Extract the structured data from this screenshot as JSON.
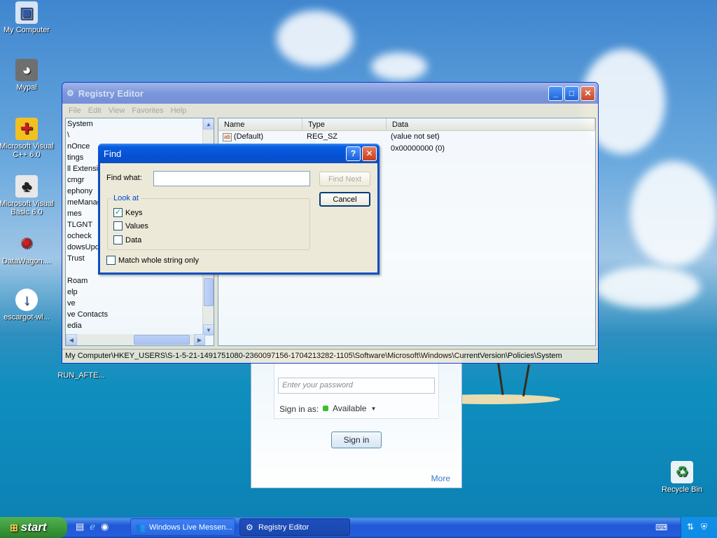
{
  "desktop": {
    "icons": [
      {
        "label": "My Computer",
        "icon": "computer-icon"
      },
      {
        "label": "Mypal",
        "icon": "raccoon-icon"
      },
      {
        "label": "Microsoft Visual C++ 6.0",
        "icon": "visual-cpp-icon"
      },
      {
        "label": "Microsoft Visual Basic 6.0",
        "icon": "visual-basic-icon"
      },
      {
        "label": "DataWagon....",
        "icon": "datawagon-icon"
      },
      {
        "label": "escargot-wl...",
        "icon": "escargot-icon"
      },
      {
        "label": "RUN_AFTE...",
        "icon": "shortcut-icon"
      },
      {
        "label": "Recycle Bin",
        "icon": "recycle-bin-icon"
      }
    ]
  },
  "messenger": {
    "password_placeholder": "Enter your password",
    "sign_in_as_label": "Sign in as:",
    "status_value": "Available",
    "sign_in_button": "Sign in",
    "more_link": "More",
    "status_color": "#3cbf2c"
  },
  "regedit": {
    "title": "Registry Editor",
    "menu": [
      "File",
      "Edit",
      "View",
      "Favorites",
      "Help"
    ],
    "tree_items": [
      "System",
      "\\",
      "nOnce",
      "tings",
      "ll Extensio",
      "cmgr",
      "ephony",
      "meManag",
      "mes",
      "TLGNT",
      "ocheck",
      "dowsUpd",
      "Trust",
      "",
      "Roam",
      "elp",
      "ve",
      "ve Contacts",
      "edia"
    ],
    "columns": [
      "Name",
      "Type",
      "Data"
    ],
    "rows": [
      {
        "name": "(Default)",
        "type": "REG_SZ",
        "data": "(value not set)"
      },
      {
        "name": "",
        "type": "",
        "data": "0x00000000 (0)"
      }
    ],
    "status_path": "My Computer\\HKEY_USERS\\S-1-5-21-1491751080-2360097156-1704213282-1105\\Software\\Microsoft\\Windows\\CurrentVersion\\Policies\\System"
  },
  "find_dialog": {
    "title": "Find",
    "find_what_label": "Find what:",
    "find_what_value": "",
    "find_next_button": "Find Next",
    "cancel_button": "Cancel",
    "look_at_label": "Look at",
    "options": [
      {
        "label": "Keys",
        "checked": true
      },
      {
        "label": "Values",
        "checked": false
      },
      {
        "label": "Data",
        "checked": false
      }
    ],
    "match_whole_label": "Match whole string only",
    "match_whole_checked": false
  },
  "taskbar": {
    "start_label": "start",
    "tasks": [
      {
        "label": "Windows Live Messen...",
        "icon": "messenger-icon"
      },
      {
        "label": "Registry Editor",
        "icon": "regedit-icon"
      }
    ]
  }
}
